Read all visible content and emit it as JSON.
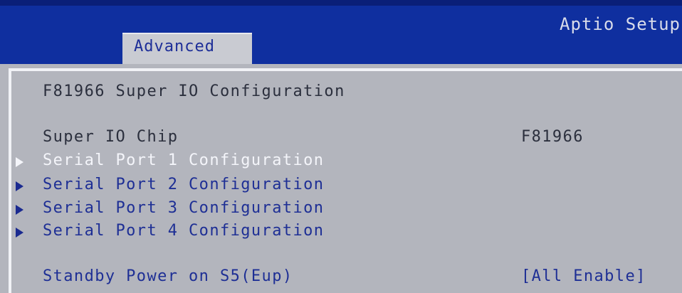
{
  "header": {
    "app_title": "Aptio Setup",
    "active_tab": "Advanced"
  },
  "page": {
    "title": "F81966 Super IO Configuration"
  },
  "info": {
    "chip_label": "Super IO Chip",
    "chip_value": "F81966"
  },
  "submenus": [
    {
      "label": "Serial Port 1 Configuration",
      "selected": true
    },
    {
      "label": "Serial Port 2 Configuration",
      "selected": false
    },
    {
      "label": "Serial Port 3 Configuration",
      "selected": false
    },
    {
      "label": "Serial Port 4 Configuration",
      "selected": false
    }
  ],
  "settings": {
    "standby_label": "Standby Power on S5(Eup)",
    "standby_value": "[All Enable]"
  },
  "colors": {
    "header_blue": "#0f2f9f",
    "panel_gray": "#b3b5bd",
    "item_blue": "#1e2f95",
    "selected_text": "#f4f5fa"
  }
}
